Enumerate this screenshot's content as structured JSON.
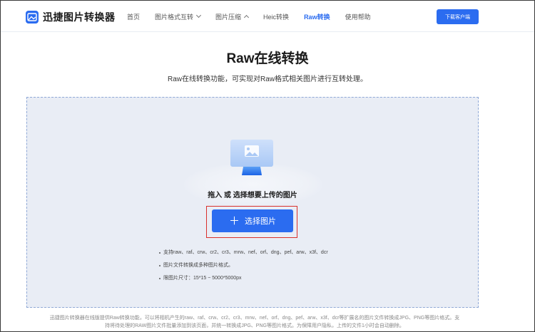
{
  "header": {
    "logo_text": "迅捷图片转换器",
    "nav": [
      {
        "label": "首页",
        "has_chevron": false
      },
      {
        "label": "图片格式互转",
        "has_chevron": true
      },
      {
        "label": "图片压缩",
        "has_chevron": true
      },
      {
        "label": "Heic转换",
        "has_chevron": false
      },
      {
        "label": "Raw转换",
        "has_chevron": false,
        "active": true
      },
      {
        "label": "使用帮助",
        "has_chevron": false
      }
    ],
    "download_label": "下载客户端"
  },
  "main": {
    "title": "Raw在线转换",
    "subtitle": "Raw在线转换功能，可实现对Raw格式相关图片进行互转处理。"
  },
  "upload": {
    "hint": "拖入 或 选择想要上传的图片",
    "button_label": "选择图片",
    "button_icon": "plus-icon",
    "notes": [
      "支持raw、raf、crw、cr2、cr3、mrw、nef、orf、dng、pef、arw、x3f、dcr",
      "图片文件转换成多种图片格式。",
      "限图片尺寸：15*15 ~ 5000*5000px"
    ]
  },
  "footer": {
    "text": "迅捷图片转换器在线版提供Raw转换功能，可以将相机产生的raw、raf、crw、cr2、cr3、mrw、nef、orf、dng、pef、arw、x3f、dcr等扩展名的图片文件转换成JPG、PNG等图片格式。支持将待处理的RAW图片文件批量添加到该页面，并统一转换成JPG、PNG等图片格式。为保障用户隐私，上传的文件1小时会自动删除。"
  },
  "colors": {
    "accent": "#2b6cf0",
    "upload_bg": "#e9edf5",
    "highlight": "#d9302c"
  }
}
